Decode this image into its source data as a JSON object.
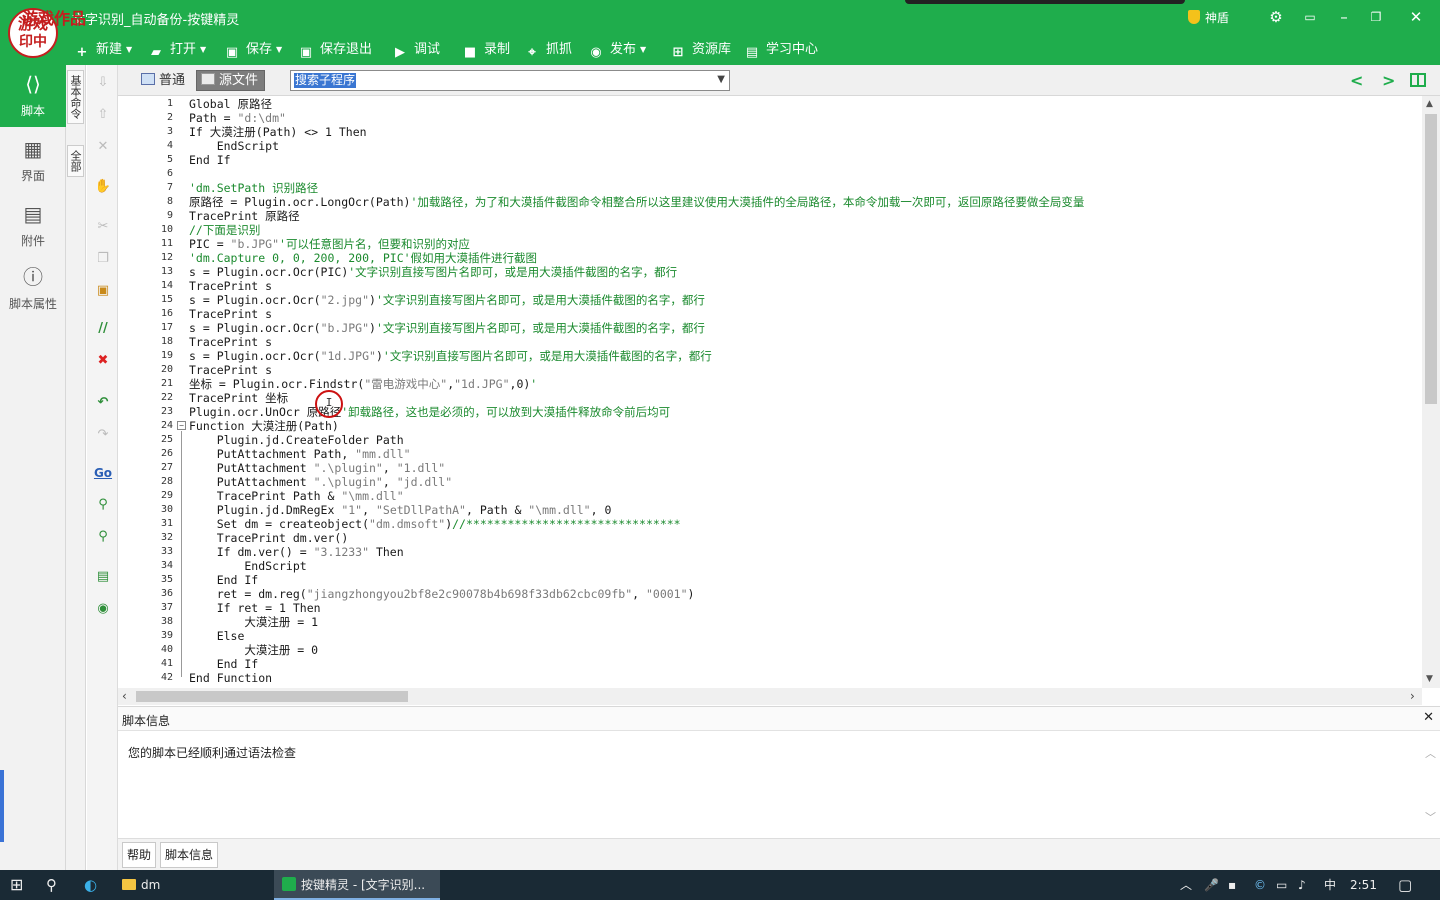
{
  "window": {
    "title": "文字识别_自动备份-按键精灵",
    "stamp_text": "游戏作品",
    "logo_lines": [
      "游戏",
      "印中"
    ],
    "shield_label": "神盾",
    "icons": [
      "gear-icon",
      "restore-box-icon",
      "minimize-icon",
      "maximize-icon",
      "close-icon"
    ]
  },
  "toolbar": {
    "new": "新建",
    "open": "打开",
    "save": "保存",
    "save_exit": "保存退出",
    "debug": "调试",
    "record": "录制",
    "capture": "抓抓",
    "publish": "发布",
    "resources": "资源库",
    "learn": "学习中心"
  },
  "leftnav": {
    "items": [
      {
        "label": "脚本",
        "icon": "script-icon"
      },
      {
        "label": "界面",
        "icon": "ui-icon"
      },
      {
        "label": "附件",
        "icon": "attachment-icon"
      },
      {
        "label": "脚本属性",
        "icon": "info-icon"
      }
    ]
  },
  "sidetabs": [
    "基本命令",
    "全部"
  ],
  "editor": {
    "tab_normal": "普通",
    "tab_source": "源文件",
    "proc_placeholder": "搜索子程序",
    "cursor_glyph": "I"
  },
  "code_lines": [
    "Global 原路径",
    "Path = \"d:\\dm\"",
    "If 大漠注册(Path) <> 1 Then",
    "    EndScript",
    "End If",
    "",
    "'dm.SetPath 识别路径",
    "原路径 = Plugin.ocr.LongOcr(Path)'加载路径，为了和大漠插件截图命令相整合所以这里建议使用大漠插件的全局路径，本命令加载一次即可，返回原路径要做全局变量",
    "TracePrint 原路径",
    "//下面是识别",
    "PIC = \"b.JPG\"'可以任意图片名，但要和识别的对应",
    "'dm.Capture 0, 0, 200, 200, PIC'假如用大漠插件进行截图",
    "s = Plugin.ocr.Ocr(PIC)'文字识别直接写图片名即可，或是用大漠插件截图的名字，都行",
    "TracePrint s",
    "s = Plugin.ocr.Ocr(\"2.jpg\")'文字识别直接写图片名即可，或是用大漠插件截图的名字，都行",
    "TracePrint s",
    "s = Plugin.ocr.Ocr(\"b.JPG\")'文字识别直接写图片名即可，或是用大漠插件截图的名字，都行",
    "TracePrint s",
    "s = Plugin.ocr.Ocr(\"1d.JPG\")'文字识别直接写图片名即可，或是用大漠插件截图的名字，都行",
    "TracePrint s",
    "坐标 = Plugin.ocr.Findstr(\"雷电游戏中心\",\"1d.JPG\",0)'",
    "TracePrint 坐标",
    "Plugin.ocr.UnOcr 原路径'卸载路径，这也是必须的，可以放到大漠插件释放命令前后均可",
    "Function 大漠注册(Path)",
    "    Plugin.jd.CreateFolder Path",
    "    PutAttachment Path, \"mm.dll\"",
    "    PutAttachment \".\\plugin\", \"1.dll\"",
    "    PutAttachment \".\\plugin\", \"jd.dll\"",
    "    TracePrint Path & \"\\mm.dll\"",
    "    Plugin.jd.DmRegEx \"1\", \"SetDllPathA\", Path & \"\\mm.dll\", 0",
    "    Set dm = createobject(\"dm.dmsoft\")//*******************************",
    "    TracePrint dm.ver()",
    "    If dm.ver() = \"3.1233\" Then",
    "        EndScript",
    "    End If",
    "    ret = dm.reg(\"jiangzhongyou2bf8e2c90078b4b698f33db62cbc09fb\", \"0001\")",
    "    If ret = 1 Then",
    "        大漠注册 = 1",
    "    Else",
    "        大漠注册 = 0",
    "    End If",
    "End Function"
  ],
  "info_panel": {
    "title": "脚本信息",
    "message": "您的脚本已经顺利通过语法检查"
  },
  "bottom_tabs": [
    "帮助",
    "脚本信息"
  ],
  "taskbar": {
    "folder": "dm",
    "app": "按键精灵 - [文字识别...",
    "ime": "中",
    "time": "2:51"
  }
}
